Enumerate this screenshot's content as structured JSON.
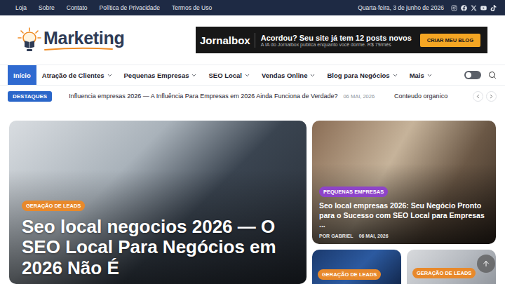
{
  "top_bar": {
    "links": [
      "Loja",
      "Sobre",
      "Contato",
      "Política de Privacidade",
      "Termos de Uso"
    ],
    "date": "Quarta-feira, 3 de junho de 2026"
  },
  "logo": {
    "text": "Marketing"
  },
  "ad": {
    "brand": "Jornalbox",
    "headline": "Acordou? Seu site já tem 12 posts novos",
    "subtext": "A IA do Jornalbox publica enquanto você dorme. R$ 79/mês",
    "button": "CRIAR MEU BLOG"
  },
  "nav": {
    "items": [
      {
        "label": "Início",
        "selected": true,
        "has_menu": false
      },
      {
        "label": "Atração de Clientes",
        "selected": false,
        "has_menu": true
      },
      {
        "label": "Pequenas Empresas",
        "selected": false,
        "has_menu": true
      },
      {
        "label": "SEO Local",
        "selected": false,
        "has_menu": true
      },
      {
        "label": "Vendas Online",
        "selected": false,
        "has_menu": true
      },
      {
        "label": "Blog para Negócios",
        "selected": false,
        "has_menu": true
      },
      {
        "label": "Mais",
        "selected": false,
        "has_menu": true
      }
    ],
    "dark_mode": {
      "on": false
    }
  },
  "ticker": {
    "label": "DESTAQUES",
    "items": [
      {
        "title": "Influencia empresas 2026 — A Influência Para Empresas em 2026 Ainda Funciona de Verdade?",
        "date": "06 MAI, 2026"
      },
      {
        "title": "Conteudo organico"
      }
    ]
  },
  "featured": {
    "tag": "GERAÇÃO DE LEADS",
    "color": "#e8892b",
    "title": "Seo local negocios 2026 — O SEO Local Para Negócios em 2026 Não É"
  },
  "side_cards": [
    {
      "tag": "PEQUENAS EMPRESAS",
      "color": "#8e44c9",
      "title": "Seo local empresas 2026: Seu Negócio Pronto para o Sucesso com SEO Local para Empresas ...",
      "by": "POR",
      "author": "GABRIEL",
      "date": "06 MAI, 2026"
    }
  ],
  "small_cards": [
    {
      "tag": "GERAÇÃO DE LEADS",
      "color": "#e8892b"
    },
    {
      "tag": "GERAÇÃO DE LEADS",
      "color": "#e8892b"
    }
  ]
}
